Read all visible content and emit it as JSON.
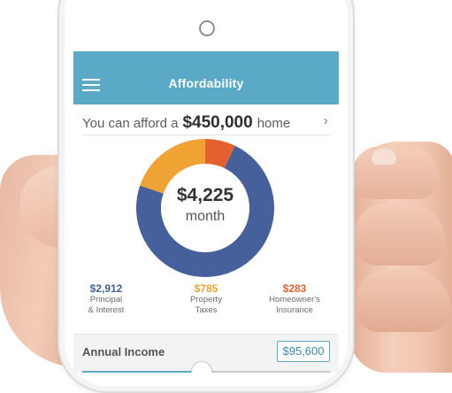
{
  "app": {
    "title": "Affordability"
  },
  "afford": {
    "prefix": "You can afford a",
    "amount": "$450,000",
    "suffix": "home"
  },
  "summary": {
    "monthly_amount": "$4,225",
    "period": "month"
  },
  "breakdown": [
    {
      "value": "$2,912",
      "label1": "Principal",
      "label2": "& Interest",
      "amount": 2912,
      "color": "#45609a"
    },
    {
      "value": "$785",
      "label1": "Property",
      "label2": "Taxes",
      "amount": 785,
      "color": "#f0a232"
    },
    {
      "value": "$283",
      "label1": "Homeowner's",
      "label2": "Insurance",
      "amount": 283,
      "color": "#e4602f"
    }
  ],
  "income": {
    "label": "Annual Income",
    "value": "$95,600",
    "slider_fraction": 0.48
  },
  "icons": {
    "menu": "hamburger-menu-icon",
    "chevron": "chevron-right-icon"
  }
}
